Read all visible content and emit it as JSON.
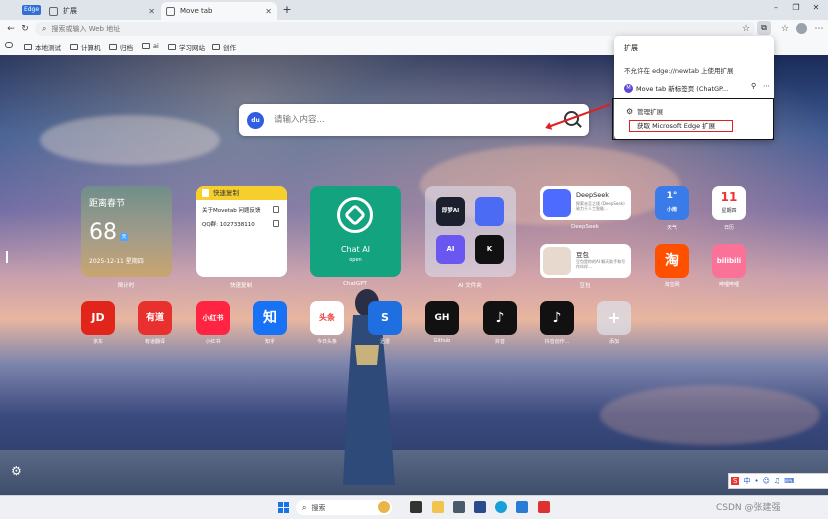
{
  "browser": {
    "badge": "Edge",
    "tabs": [
      {
        "label": "扩展",
        "active": false
      },
      {
        "label": "Move tab",
        "active": true
      }
    ],
    "address_placeholder": "搜索或输入 Web 地址",
    "bookmarks": [
      "本地测试",
      "计算机",
      "归档",
      "ai",
      "学习网站",
      "创作"
    ]
  },
  "ntp": {
    "search_placeholder": "请输入内容...",
    "search_engine_logo": "du",
    "countdown": {
      "title": "距离春节",
      "days": "68",
      "unit": "天",
      "date": "2025-12-11 星期四",
      "label": "倒计时"
    },
    "quickcopy": {
      "title": "快速复制",
      "line1": "关于Movetab 问题反馈",
      "line2": "QQ群: 1027338110",
      "label": "快速复制"
    },
    "chatai": {
      "name": "Chat AI",
      "sub": "open",
      "label": "ChatGPT"
    },
    "ai_folder": {
      "items": [
        "即梦AI",
        "",
        "AI",
        "K"
      ],
      "label": "AI 文件夹"
    },
    "deepseek": {
      "title": "DeepSeek",
      "desc": "探索未至之境 (DeepSeek) 致力于人工智能…",
      "label": "DeepSeek"
    },
    "doubao": {
      "title": "豆包",
      "desc": "豆包是你的AI 聊天助手和写作伙伴…",
      "label": "豆包"
    },
    "weather": {
      "temp": "1°",
      "cond": "小雨",
      "label": "天气"
    },
    "calendar": {
      "day": "11",
      "weekday": "星期四",
      "label": "日历"
    },
    "taobao": {
      "glyph": "淘",
      "label": "淘宝网"
    },
    "bilibili": {
      "glyph": "bilibili",
      "label": "哔哩哔哩"
    },
    "apps": [
      {
        "glyph": "JD",
        "label": "京东",
        "color": "#e1251b"
      },
      {
        "glyph": "有道",
        "label": "有道翻译",
        "color": "#e8302f"
      },
      {
        "glyph": "小红书",
        "label": "小红书",
        "color": "#ff2442"
      },
      {
        "glyph": "知",
        "label": "知乎",
        "color": "#1772f6"
      },
      {
        "glyph": "头条",
        "label": "今日头条",
        "color": "#f85959"
      },
      {
        "glyph": "S",
        "label": "迅雷",
        "color": "#1f6fe0"
      },
      {
        "glyph": "GH",
        "label": "Github",
        "color": "#111111"
      },
      {
        "glyph": "♪",
        "label": "抖音",
        "color": "#111111"
      },
      {
        "glyph": "♪",
        "label": "抖音创作...",
        "color": "#111111"
      },
      {
        "glyph": "+",
        "label": "添加",
        "color": "#c7ccd6"
      }
    ]
  },
  "ext_popup": {
    "title": "扩展",
    "not_allowed": "不允许在 edge://newtab 上使用扩展",
    "ext_name": "Move tab 新标签页 (ChatGP...",
    "manage": "管理扩展",
    "get": "获取 Microsoft Edge 扩展"
  },
  "taskbar": {
    "search": "搜索"
  },
  "watermark": "CSDN @张建强"
}
